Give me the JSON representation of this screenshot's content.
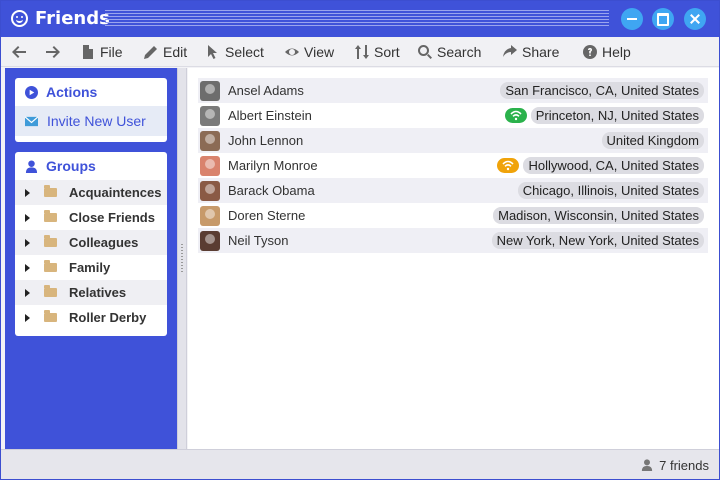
{
  "window": {
    "title": "Friends"
  },
  "toolbar": {
    "file": "File",
    "edit": "Edit",
    "select": "Select",
    "view": "View",
    "sort": "Sort",
    "search": "Search",
    "share": "Share",
    "help": "Help"
  },
  "sidebar": {
    "actions": {
      "heading": "Actions",
      "invite": "Invite New User"
    },
    "groups": {
      "heading": "Groups",
      "items": [
        "Acquaintences",
        "Close Friends",
        "Colleagues",
        "Family",
        "Relatives",
        "Roller Derby"
      ]
    }
  },
  "friends": [
    {
      "name": "Ansel Adams",
      "location": "San Francisco, CA, United States",
      "avatar_color": "#6d6d6d",
      "status": null
    },
    {
      "name": "Albert Einstein",
      "location": "Princeton, NJ, United States",
      "avatar_color": "#7a7a7a",
      "status": "online"
    },
    {
      "name": "John Lennon",
      "location": "United Kingdom",
      "avatar_color": "#8b6b55",
      "status": null
    },
    {
      "name": "Marilyn Monroe",
      "location": "Hollywood, CA, United States",
      "avatar_color": "#d9836d",
      "status": "away"
    },
    {
      "name": "Barack Obama",
      "location": "Chicago, Illinois, United States",
      "avatar_color": "#8a5a45",
      "status": null
    },
    {
      "name": "Doren Sterne",
      "location": "Madison, Wisconsin, United States",
      "avatar_color": "#c79a6a",
      "status": null
    },
    {
      "name": "Neil Tyson",
      "location": "New York, New York, United States",
      "avatar_color": "#5a3d32",
      "status": null
    }
  ],
  "status_colors": {
    "online": "#2bb24c",
    "away": "#f0a30a"
  },
  "statusbar": {
    "count": "7 friends"
  },
  "colors": {
    "accent": "#3f52d9",
    "window_button": "#3fa6f2"
  }
}
